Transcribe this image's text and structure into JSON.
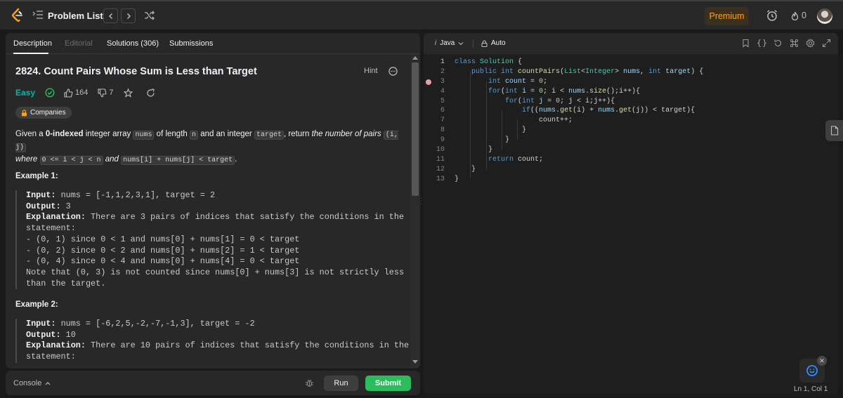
{
  "topbar": {
    "title": "Problem List",
    "premium_label": "Premium",
    "streak_count": "0"
  },
  "tabs": [
    {
      "label": "Description"
    },
    {
      "label": "Editorial"
    },
    {
      "label": "Solutions (306)"
    },
    {
      "label": "Submissions"
    }
  ],
  "problem": {
    "title": "2824. Count Pairs Whose Sum is Less than Target",
    "hint_label": "Hint",
    "difficulty": "Easy",
    "likes": "164",
    "dislikes": "7",
    "companies_label": "Companies"
  },
  "description": {
    "p1": "Given a ",
    "p1_bold": "0-indexed",
    "p2": " integer array ",
    "c_nums": "nums",
    "p3": " of length ",
    "c_n": "n",
    "p4": " and an integer ",
    "c_target": "target",
    "p5": ", return ",
    "p5_em": "the number of pairs",
    "c_pair": "(i, j)",
    "p6_em": "where",
    "c_cond": "0 <= i < j < n",
    "p7_em": "and",
    "c_sum": "nums[i] + nums[j] < target",
    "p8": "."
  },
  "example1": {
    "heading": "Example 1:",
    "input_label": "Input:",
    "input": " nums = [-1,1,2,3,1], target = 2",
    "output_label": "Output:",
    "output": " 3",
    "explanation_label": "Explanation:",
    "explanation": " There are 3 pairs of indices that satisfy the conditions in the\nstatement:\n- (0, 1) since 0 < 1 and nums[0] + nums[1] = 0 < target\n- (0, 2) since 0 < 2 and nums[0] + nums[2] = 1 < target\n- (0, 4) since 0 < 4 and nums[0] + nums[4] = 0 < target\nNote that (0, 3) is not counted since nums[0] + nums[3] is not strictly less\nthan the target."
  },
  "example2": {
    "heading": "Example 2:",
    "input_label": "Input:",
    "input": " nums = [-6,2,5,-2,-7,-1,3], target = -2",
    "output_label": "Output:",
    "output": " 10",
    "explanation_label": "Explanation:",
    "explanation": " There are 10 pairs of indices that satisfy the conditions in the\nstatement:"
  },
  "console": {
    "label": "Console",
    "run_label": "Run",
    "submit_label": "Submit"
  },
  "editor": {
    "language": "Java",
    "mode": "Auto",
    "status": "Ln 1, Col 1",
    "lines": [
      {
        "num": "1"
      },
      {
        "num": "2"
      },
      {
        "num": "3"
      },
      {
        "num": "4"
      },
      {
        "num": "5"
      },
      {
        "num": "6"
      },
      {
        "num": "7"
      },
      {
        "num": "8"
      },
      {
        "num": "9"
      },
      {
        "num": "10"
      },
      {
        "num": "11"
      },
      {
        "num": "12"
      },
      {
        "num": "13"
      }
    ],
    "code": {
      "l1_k": "class",
      "l1_t": " Solution",
      "l1_p": " {",
      "l2_k1": "public",
      "l2_k2": " int",
      "l2_f": " countPairs",
      "l2_p1": "(",
      "l2_t1": "List",
      "l2_p2": "<",
      "l2_t2": "Integer",
      "l2_p3": ">",
      "l2_v1": " nums",
      "l2_p4": ",",
      "l2_k3": " int",
      "l2_v2": " target",
      "l2_p5": ") {",
      "l3_k": "int",
      "l3_v": " count",
      "l3_p1": " = ",
      "l3_n": "0",
      "l3_p2": ";",
      "l4_k1": "for",
      "l4_p1": "(",
      "l4_k2": "int",
      "l4_v1": " i",
      "l4_p2": " = ",
      "l4_n": "0",
      "l4_p3": "; i < ",
      "l4_v2": "nums",
      "l4_p4": ".",
      "l4_f": "size",
      "l4_p5": "();i++){",
      "l5_k1": "for",
      "l5_p1": "(",
      "l5_k2": "int",
      "l5_v1": " j",
      "l5_p2": " = ",
      "l5_n": "0",
      "l5_p3": "; j < i;j++){",
      "l6_k": "if",
      "l6_p1": "((",
      "l6_v1": "nums",
      "l6_p2": ".",
      "l6_f1": "get",
      "l6_p3": "(i) + ",
      "l6_v2": "nums",
      "l6_p4": ".",
      "l6_f2": "get",
      "l6_p5": "(j)) < target){",
      "l7": "count++;",
      "l8": "}",
      "l9": "}",
      "l10": "}",
      "l11_k": "return",
      "l11_p": " count;",
      "l12": "}",
      "l13": "}"
    }
  }
}
